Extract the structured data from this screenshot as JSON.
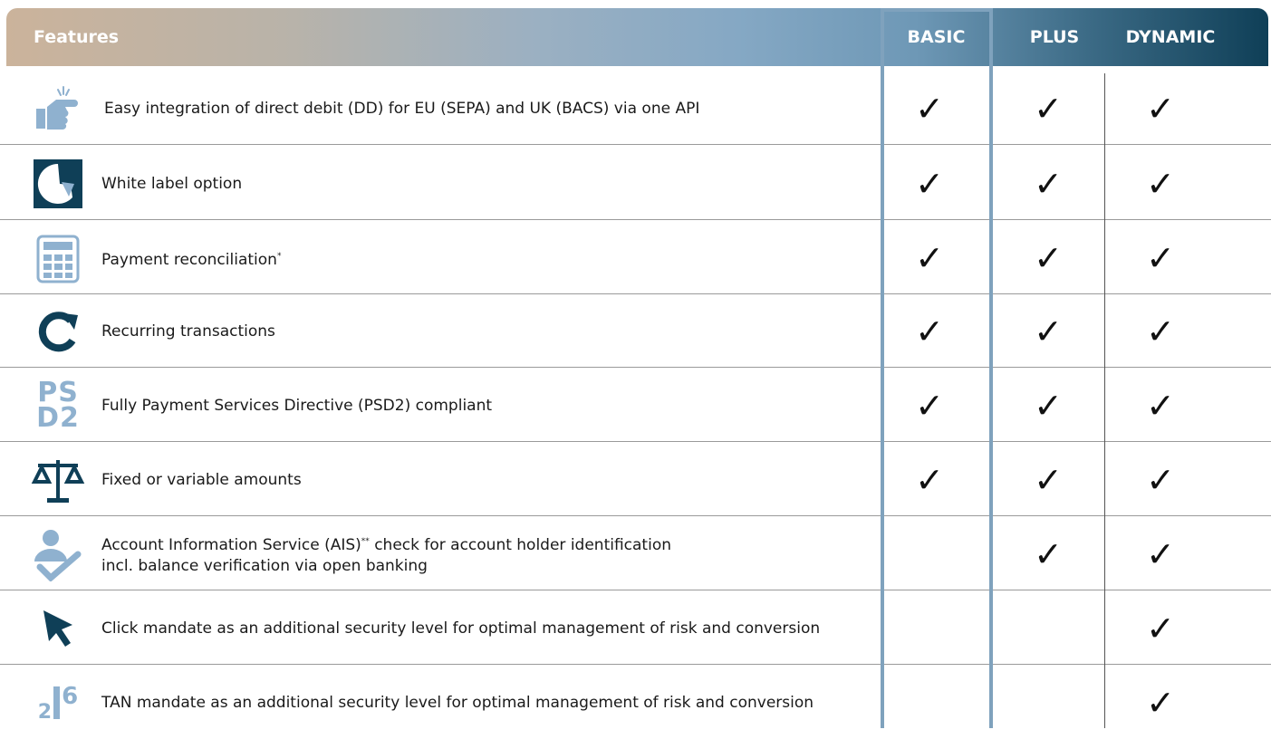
{
  "header": {
    "features": "Features",
    "basic": "BASIC",
    "plus": "PLUS",
    "dynamic": "DYNAMIC"
  },
  "rows": [
    {
      "label": "Easy integration of direct debit (DD) for EU (SEPA) and UK (BACS) via one API",
      "icon": "pointing-hand-icon",
      "basic": "✓",
      "plus": "✓",
      "dynamic": "✓"
    },
    {
      "label": "White label option",
      "icon": "sticker-peel-icon",
      "basic": "✓",
      "plus": "✓",
      "dynamic": "✓"
    },
    {
      "label": "Payment reconciliation",
      "label_sup": "*",
      "icon": "calculator-icon",
      "basic": "✓",
      "plus": "✓",
      "dynamic": "✓"
    },
    {
      "label": "Recurring transactions",
      "icon": "refresh-icon",
      "basic": "✓",
      "plus": "✓",
      "dynamic": "✓"
    },
    {
      "label": "Fully Payment Services Directive (PSD2) compliant",
      "icon": "psd2-icon",
      "icon_text_top": "PS",
      "icon_text_bottom": "D2",
      "basic": "✓",
      "plus": "✓",
      "dynamic": "✓"
    },
    {
      "label": "Fixed or variable amounts",
      "icon": "balance-scale-icon",
      "basic": "✓",
      "plus": "✓",
      "dynamic": "✓"
    },
    {
      "label": "Account Information Service (AIS)",
      "label_sup": "**",
      "label_rest": " check for account holder identification",
      "label_line2": "incl. balance verification via open banking",
      "icon": "user-check-icon",
      "basic": "",
      "plus": "✓",
      "dynamic": "✓"
    },
    {
      "label": "Click mandate as an additional security level for optimal management of risk and conversion",
      "icon": "cursor-arrow-icon",
      "basic": "",
      "plus": "",
      "dynamic": "✓"
    },
    {
      "label": "TAN mandate as an additional security level for optimal management of risk and conversion",
      "icon": "tan-number-icon",
      "icon_text_small": "2",
      "icon_text_big": "6",
      "basic": "",
      "plus": "",
      "dynamic": "✓"
    }
  ],
  "colors": {
    "header_start": "#cbb39b",
    "header_end": "#0f3f57",
    "basic_border": "#7fa2bd",
    "icon_blue": "#8fb1cf",
    "icon_dark": "#0f3f57"
  }
}
